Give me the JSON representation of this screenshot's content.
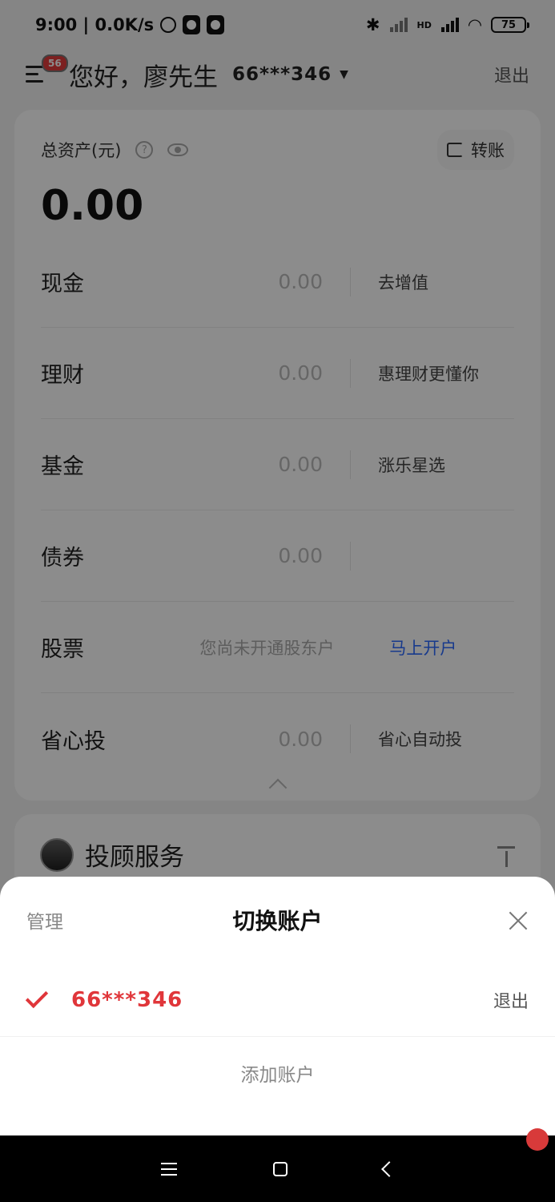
{
  "status_bar": {
    "time_speed": "9:00 | 0.0K/s",
    "battery": "75",
    "hd_label": "HD"
  },
  "header": {
    "menu_badge": "56",
    "greeting": "您好，廖先生",
    "account_id": "66***346",
    "logout": "退出"
  },
  "assets": {
    "title": "总资产(元)",
    "transfer_label": "转账",
    "total": "0.00",
    "rows": [
      {
        "label": "现金",
        "value": "0.00",
        "action": "去增值"
      },
      {
        "label": "理财",
        "value": "0.00",
        "action": "惠理财更懂你"
      },
      {
        "label": "基金",
        "value": "0.00",
        "action": "涨乐星选"
      },
      {
        "label": "债券",
        "value": "0.00",
        "action": ""
      },
      {
        "label": "股票",
        "value": "您尚未开通股东户",
        "action": "马上开户"
      },
      {
        "label": "省心投",
        "value": "0.00",
        "action": "省心自动投"
      }
    ]
  },
  "advisor": {
    "title": "投顾服务"
  },
  "sheet": {
    "manage": "管理",
    "title": "切换账户",
    "account_id": "66***346",
    "logout": "退出",
    "add_account": "添加账户"
  },
  "colors": {
    "accent_red": "#e0363a",
    "link_blue": "#2d6bff"
  }
}
